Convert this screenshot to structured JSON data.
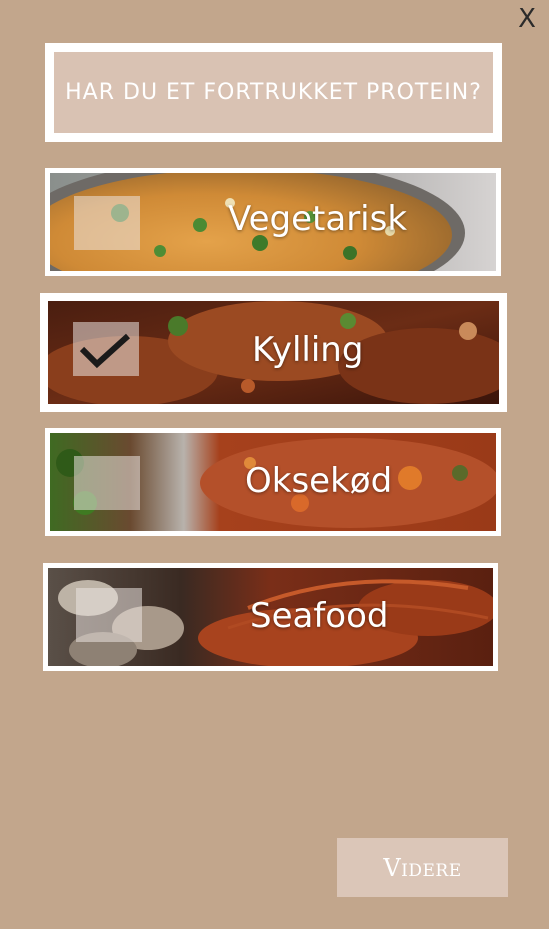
{
  "close_label": "X",
  "title": "HAR DU ET FORTRUKKET PROTEIN?",
  "options": [
    {
      "label": "Vegetarisk",
      "selected": false
    },
    {
      "label": "Kylling",
      "selected": true
    },
    {
      "label": "Oksekød",
      "selected": false
    },
    {
      "label": "Seafood",
      "selected": false
    }
  ],
  "next_label": "Videre",
  "colors": {
    "background": "#c2a68c",
    "title_fill": "#d9c2b3",
    "button_fill": "#dbc6b8",
    "frame": "#ffffff",
    "checkmark": "#1a1a1a"
  },
  "icons": {
    "close": "close-icon",
    "check": "checkmark-icon"
  }
}
